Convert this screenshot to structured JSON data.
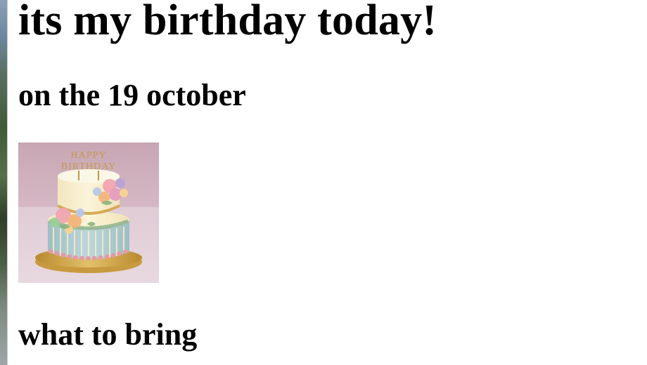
{
  "page": {
    "heading": "its my birthday today!",
    "date_heading": "on the 19 october",
    "section_heading": "what to bring"
  },
  "image": {
    "alt": "birthday cake",
    "topper_text": "HAPPY BIRTHDAY"
  },
  "colors": {
    "text": "#000000",
    "background": "#ffffff"
  }
}
